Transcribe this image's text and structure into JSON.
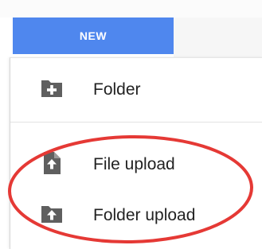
{
  "new_button": {
    "label": "NEW"
  },
  "menu": {
    "items": [
      {
        "label": "Folder",
        "icon": "folder-plus-icon"
      },
      {
        "label": "File upload",
        "icon": "file-upload-icon"
      },
      {
        "label": "Folder upload",
        "icon": "folder-upload-icon"
      }
    ]
  },
  "colors": {
    "new_button_bg": "#4f87ee",
    "icon_gray": "#5f5f5f",
    "highlight_red": "#e53935"
  }
}
